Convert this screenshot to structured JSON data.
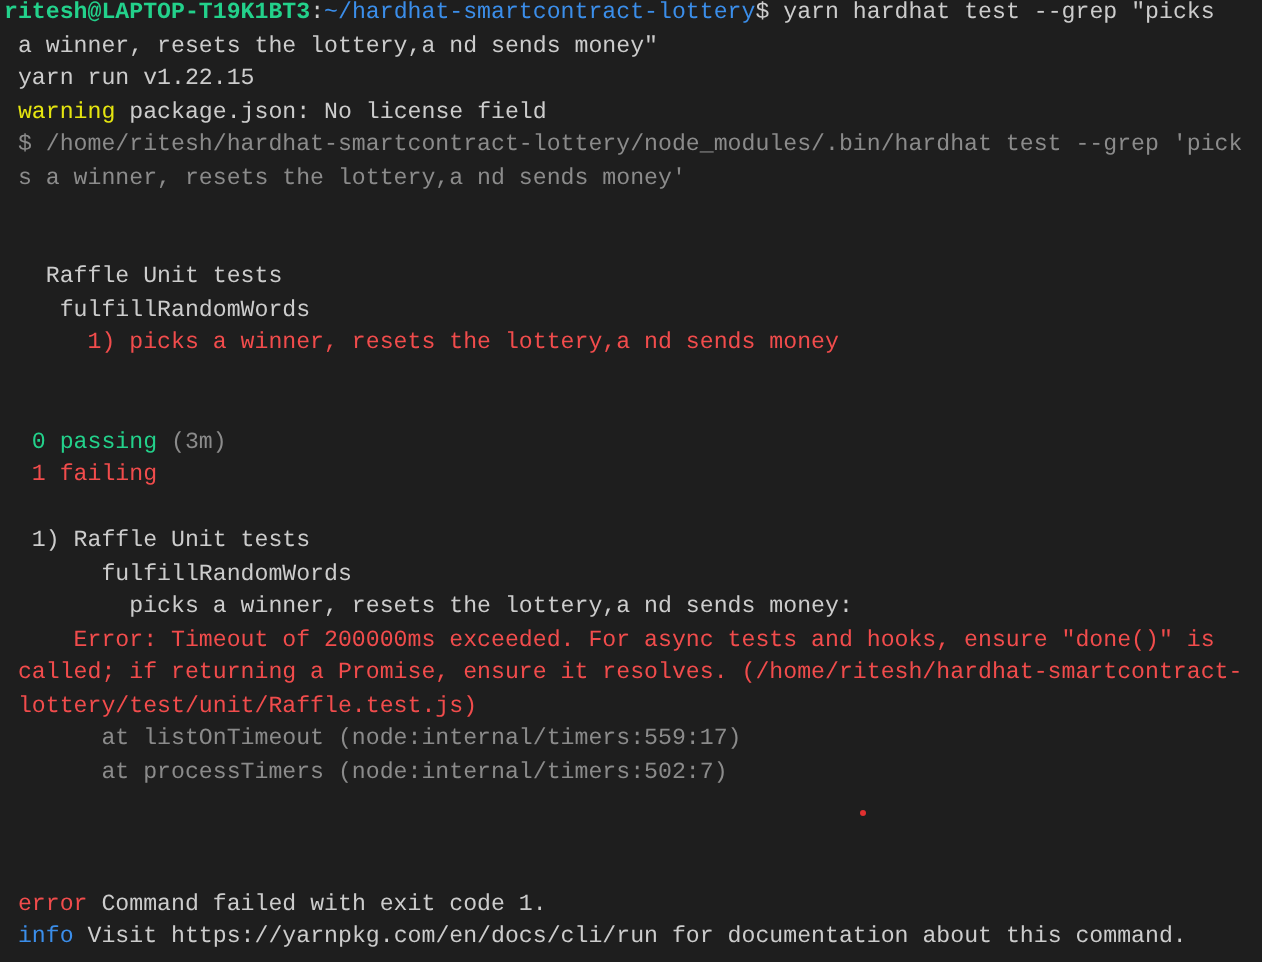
{
  "terminal": {
    "lines": [
      {
        "kind": "text",
        "segments": [
          {
            "kind": "user",
            "text": "ritesh@LAPTOP-T19K1BT3"
          },
          {
            "kind": "plain",
            "text": ":"
          },
          {
            "kind": "path",
            "text": "~/hardhat-smartcontract-lottery"
          },
          {
            "kind": "plain",
            "text": "$ yarn hardhat test --grep \"picks"
          }
        ]
      },
      {
        "kind": "text",
        "segments": [
          {
            "kind": "plain",
            "text": " a winner, resets the lottery,a nd sends money\""
          }
        ]
      },
      {
        "kind": "text",
        "segments": [
          {
            "kind": "plain",
            "text": " yarn run v1.22.15"
          }
        ]
      },
      {
        "kind": "text",
        "segments": [
          {
            "kind": "warning",
            "text": " warning"
          },
          {
            "kind": "plain",
            "text": " package.json: No license field"
          }
        ]
      },
      {
        "kind": "text",
        "segments": [
          {
            "kind": "dim",
            "text": " $ /home/ritesh/hardhat-smartcontract-lottery/node_modules/.bin/hardhat test --grep 'pick"
          }
        ]
      },
      {
        "kind": "text",
        "segments": [
          {
            "kind": "dim",
            "text": " s a winner, resets the lottery,a nd sends money'"
          }
        ]
      },
      {
        "kind": "blank"
      },
      {
        "kind": "blank"
      },
      {
        "kind": "text",
        "segments": [
          {
            "kind": "plain",
            "text": "   Raffle Unit tests"
          }
        ]
      },
      {
        "kind": "text",
        "segments": [
          {
            "kind": "plain",
            "text": "    fulfillRandomWords"
          }
        ]
      },
      {
        "kind": "text",
        "segments": [
          {
            "kind": "error",
            "text": "      1) picks a winner, resets the lottery,a nd sends money"
          }
        ]
      },
      {
        "kind": "blank"
      },
      {
        "kind": "blank"
      },
      {
        "kind": "text",
        "segments": [
          {
            "kind": "success",
            "text": "  0 passing"
          },
          {
            "kind": "dim",
            "text": " (3m)"
          }
        ]
      },
      {
        "kind": "text",
        "segments": [
          {
            "kind": "error",
            "text": "  1 failing"
          }
        ]
      },
      {
        "kind": "blank"
      },
      {
        "kind": "text",
        "segments": [
          {
            "kind": "plain",
            "text": "  1) Raffle Unit tests"
          }
        ]
      },
      {
        "kind": "text",
        "segments": [
          {
            "kind": "plain",
            "text": "       fulfillRandomWords"
          }
        ]
      },
      {
        "kind": "text",
        "segments": [
          {
            "kind": "plain",
            "text": "         picks a winner, resets the lottery,a nd sends money:"
          }
        ]
      },
      {
        "kind": "text",
        "segments": [
          {
            "kind": "error",
            "text": "     Error: Timeout of 200000ms exceeded. For async tests and hooks, ensure \"done()\" is"
          }
        ]
      },
      {
        "kind": "text",
        "segments": [
          {
            "kind": "error",
            "text": " called; if returning a Promise, ensure it resolves. (/home/ritesh/hardhat-smartcontract-"
          }
        ]
      },
      {
        "kind": "text",
        "segments": [
          {
            "kind": "error",
            "text": " lottery/test/unit/Raffle.test.js)"
          }
        ]
      },
      {
        "kind": "text",
        "segments": [
          {
            "kind": "dim",
            "text": "       at listOnTimeout (node:internal/timers:559:17)"
          }
        ]
      },
      {
        "kind": "text",
        "segments": [
          {
            "kind": "dim",
            "text": "       at processTimers (node:internal/timers:502:7)"
          }
        ]
      },
      {
        "kind": "blank"
      },
      {
        "kind": "blank"
      },
      {
        "kind": "blank"
      },
      {
        "kind": "text",
        "segments": [
          {
            "kind": "error",
            "text": " error"
          },
          {
            "kind": "plain",
            "text": " Command failed with exit code 1."
          }
        ]
      },
      {
        "kind": "text",
        "segments": [
          {
            "kind": "info",
            "text": " info"
          },
          {
            "kind": "plain",
            "text": " Visit https://yarnpkg.com/en/docs/cli/run for documentation about this command."
          }
        ]
      }
    ]
  }
}
